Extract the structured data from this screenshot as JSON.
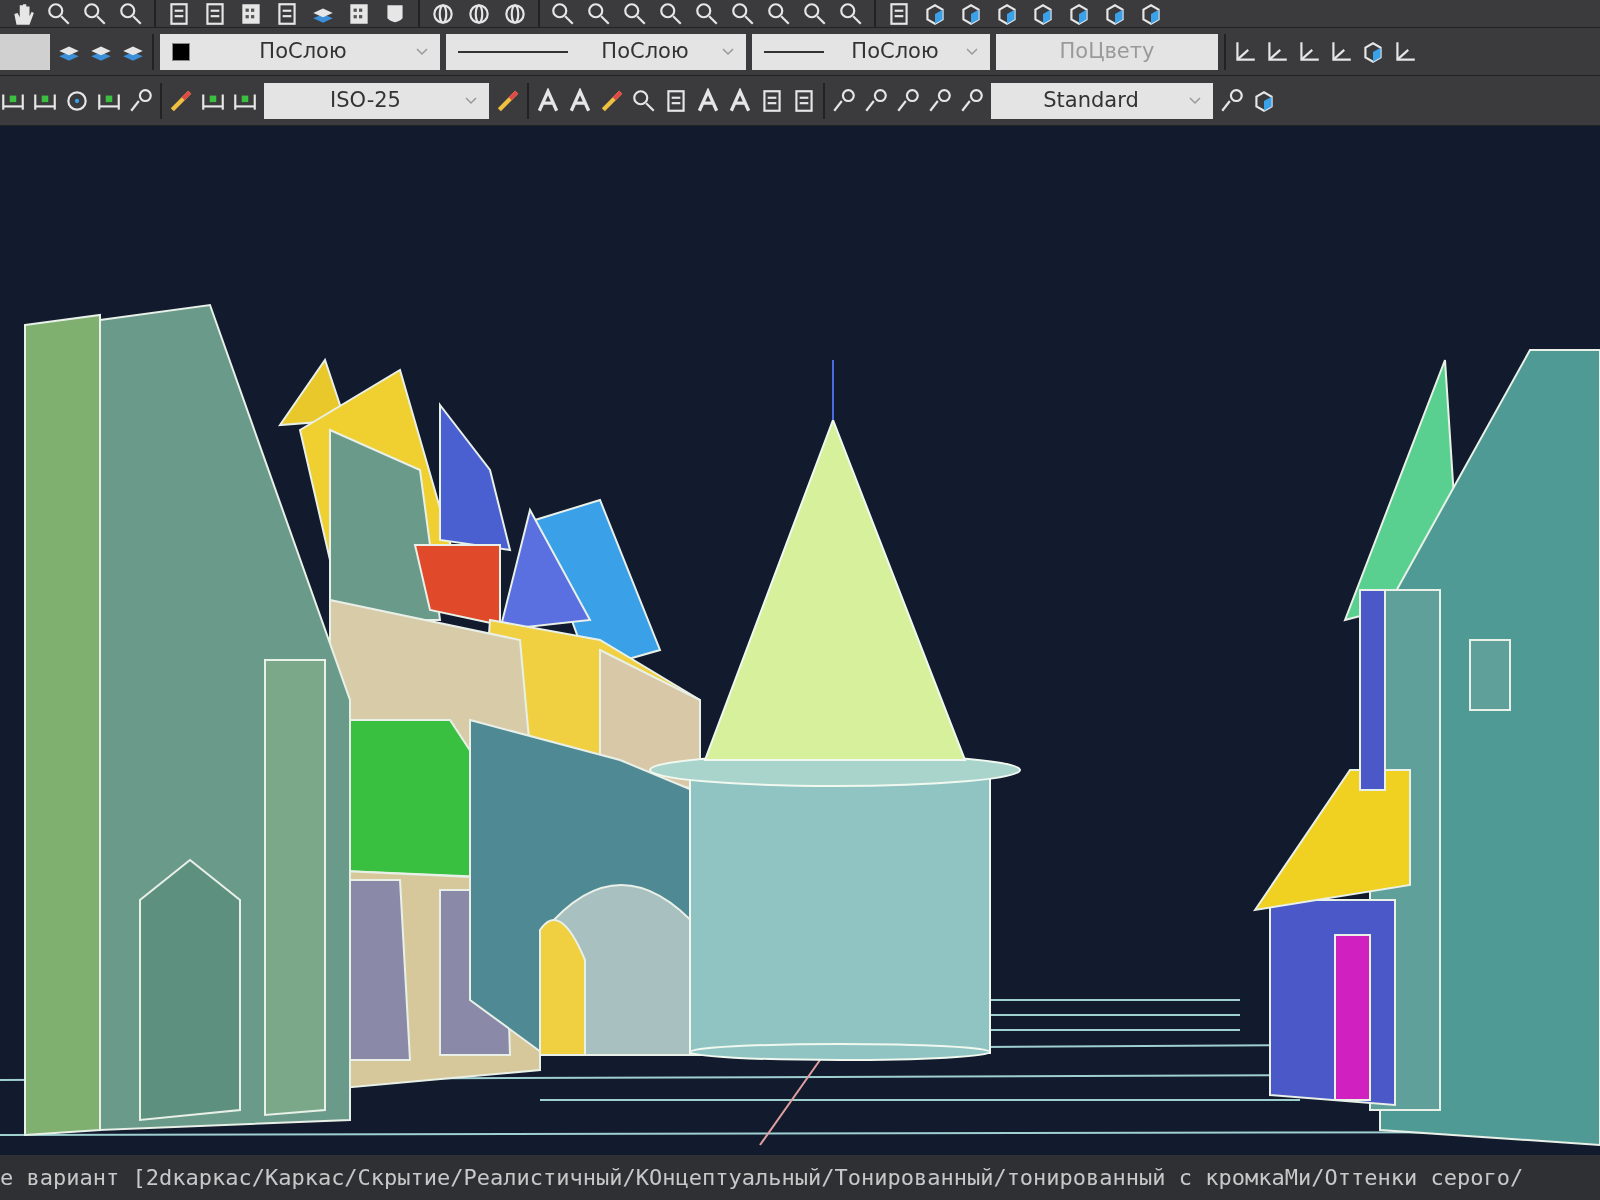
{
  "layer_toolbar": {
    "dropdowns": [
      {
        "kind": "color",
        "value": "ПоСлою",
        "disabled": false
      },
      {
        "kind": "linetype",
        "value": "ПоСлою",
        "disabled": false
      },
      {
        "kind": "lineweight",
        "value": "ПоСлою",
        "disabled": false
      },
      {
        "kind": "plotstyle",
        "value": "ПоЦвету",
        "disabled": true
      }
    ]
  },
  "annotation_toolbar": {
    "dimension_style": "ISO-25",
    "multileader_style": "Standard"
  },
  "command_line": {
    "text": "е вариант [2dкаркас/Каркас/Скрытие/Реалистичный/КОнцептуальный/Тонированный/тонированный с кромкаМи/Оттенки серого/"
  }
}
